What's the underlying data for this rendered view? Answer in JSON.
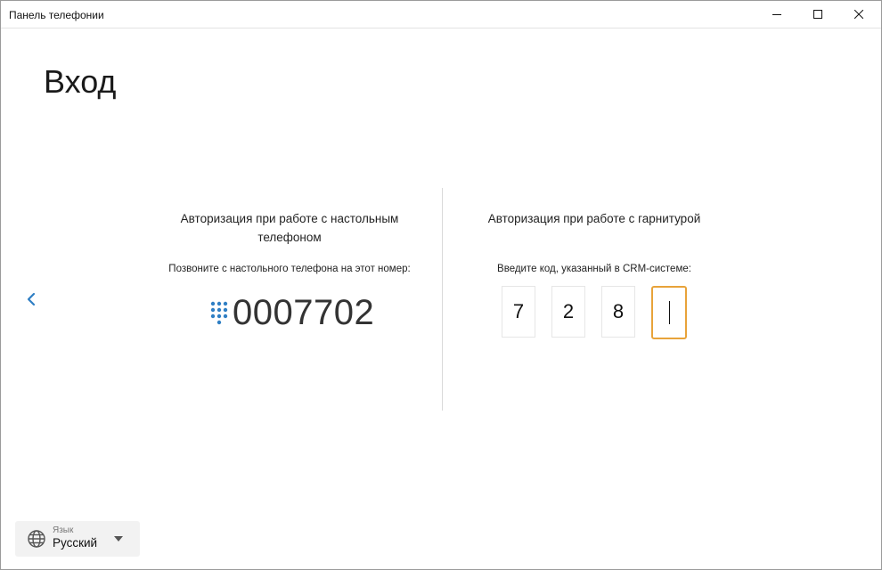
{
  "window": {
    "title": "Панель телефонии"
  },
  "page": {
    "title": "Вход"
  },
  "desk_phone": {
    "heading": "Авторизация при работе с настольным телефоном",
    "instruction": "Позвоните с настольного телефона на этот номер:",
    "number": "0007702",
    "icon": "dialpad-icon"
  },
  "headset": {
    "heading": "Авторизация при работе с гарнитурой",
    "instruction": "Введите код, указанный в CRM-системе:",
    "code_digits": [
      "7",
      "2",
      "8",
      ""
    ]
  },
  "language": {
    "caption": "Язык",
    "value": "Русский",
    "icon": "globe-icon"
  },
  "colors": {
    "accent_blue": "#2f7fc4",
    "active_border": "#e8a33a"
  }
}
